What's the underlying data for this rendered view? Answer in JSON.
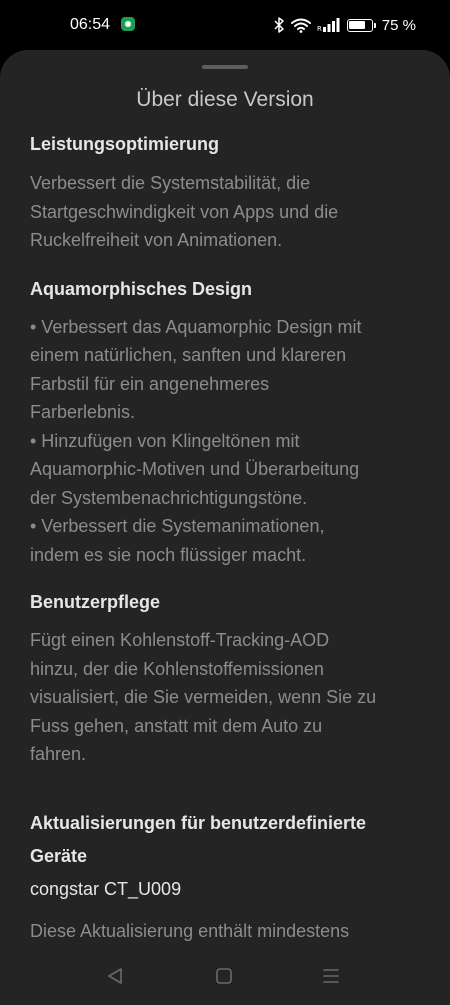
{
  "status_bar": {
    "time": "06:54",
    "battery_percent": "75 %",
    "battery_level": 0.75,
    "icons": [
      "app-notification-icon",
      "bluetooth-icon",
      "wifi-icon",
      "signal-icon",
      "battery-icon"
    ]
  },
  "sheet": {
    "title": "Über diese Version",
    "sections": [
      {
        "heading": "Leistungsoptimierung",
        "body": "Verbessert die Systemstabilität, die\nStartgeschwindigkeit von Apps und die\nRuckelfreiheit von Animationen."
      },
      {
        "heading": "Aquamorphisches Design",
        "body": "• Verbessert das Aquamorphic Design mit\neinem natürlichen, sanften und klareren\nFarbstil für ein angenehmeres\nFarberlebnis.\n• Hinzufügen von Klingeltönen mit\nAquamorphic-Motiven und Überarbeitung\nder Systembenachrichtigungstöne.\n• Verbessert die Systemanimationen,\nindem es sie noch flüssiger macht."
      },
      {
        "heading": "Benutzerpflege",
        "body": "Fügt einen Kohlenstoff-Tracking-AOD\nhinzu, der die Kohlenstoffemissionen\nvisualisiert, die Sie vermeiden, wenn Sie zu\nFuss gehen, anstatt mit dem Auto zu\nfahren."
      },
      {
        "heading": "Aktualisierungen für benutzerdefinierte\nGeräte",
        "device": "congstar CT_U009",
        "body": "Diese Aktualisierung enthält mindestens"
      }
    ]
  },
  "nav_bar": {
    "buttons": [
      "back-icon",
      "home-icon",
      "menu-icon"
    ]
  },
  "colors": {
    "background": "#000000",
    "sheet": "#242424",
    "heading": "#e6e6e6",
    "body": "#8c8c8c",
    "title": "#c8c8c8",
    "notification": "#1f9d55"
  }
}
